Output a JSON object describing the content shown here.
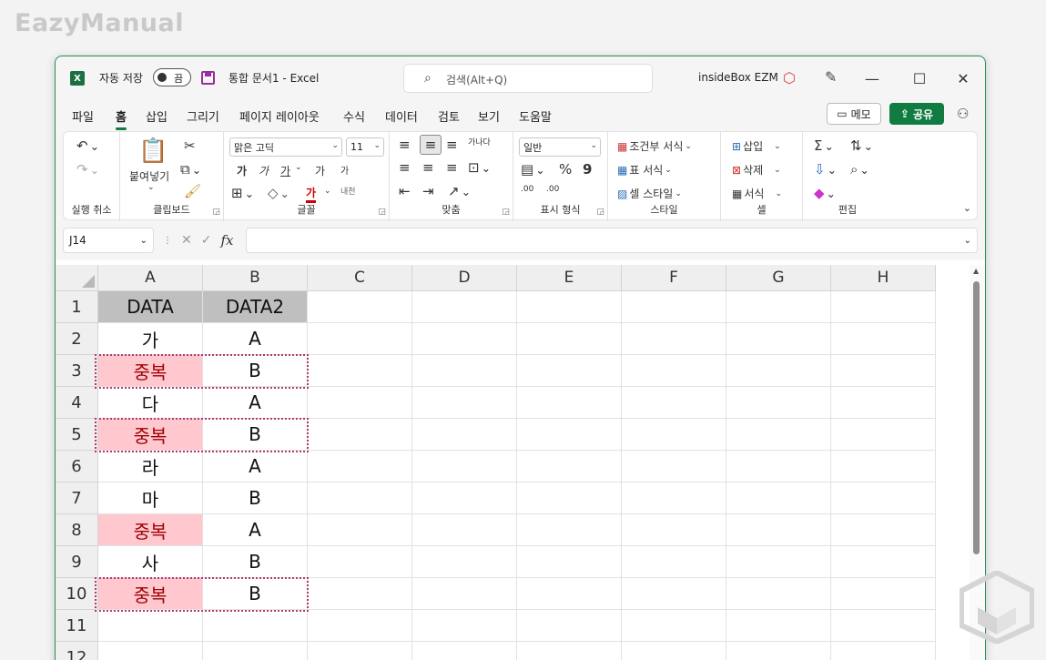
{
  "watermark": "EazyManual",
  "titlebar": {
    "app_icon": "X",
    "autosave_label": "자동 저장",
    "autosave_state": "끔",
    "doc_title": "통합 문서1  -  Excel",
    "search_placeholder": "검색(Alt+Q)",
    "account": "insideBox EZM",
    "minimize": "—",
    "maximize": "☐",
    "close": "✕"
  },
  "menu": {
    "items": [
      "파일",
      "홈",
      "삽입",
      "그리기",
      "페이지 레이아웃",
      "수식",
      "데이터",
      "검토",
      "보기",
      "도움말"
    ],
    "active": "홈",
    "memo": "메모",
    "share": "공유"
  },
  "ribbon": {
    "undo_group": "실행 취소",
    "clipboard_group": "클립보드",
    "paste": "붙여넣기",
    "font_group": "글꼴",
    "font_name": "맑은 고딕",
    "font_size": "11",
    "bold": "가",
    "italic": "가",
    "underline": "가",
    "grow_font": "가",
    "shrink_font": "가",
    "font_color": "가",
    "phonetic": "내천",
    "align_group": "맞춤",
    "wrap": "가나다",
    "number_group": "표시 형식",
    "number_format": "일반",
    "percent": "%",
    "comma": "9",
    "dec_inc": ".00",
    "dec_dec": ".00",
    "style_group": "스타일",
    "conditional": "조건부 서식",
    "format_table": "표 서식",
    "cell_style": "셀 스타일",
    "cells_group": "셀",
    "insert": "삽입",
    "delete": "삭제",
    "format": "서식",
    "edit_group": "편집"
  },
  "formula": {
    "namebox": "J14",
    "fx": "fx",
    "cancel": "✕",
    "enter": "✓"
  },
  "sheet": {
    "columns": [
      "A",
      "B",
      "C",
      "D",
      "E",
      "F",
      "G",
      "H"
    ],
    "rows": [
      "1",
      "2",
      "3",
      "4",
      "5",
      "6",
      "7",
      "8",
      "9",
      "10",
      "11",
      "12"
    ],
    "data": [
      [
        "DATA",
        "DATA2"
      ],
      [
        "가",
        "A"
      ],
      [
        "중복",
        "B"
      ],
      [
        "다",
        "A"
      ],
      [
        "중복",
        "B"
      ],
      [
        "라",
        "A"
      ],
      [
        "마",
        "B"
      ],
      [
        "중복",
        "A"
      ],
      [
        "사",
        "B"
      ],
      [
        "중복",
        "B"
      ],
      [
        "",
        ""
      ],
      [
        "",
        ""
      ]
    ],
    "duplicate_fill": "#ffc7ce",
    "duplicate_text": "#9c0006",
    "header_fill": "#bfbfbf",
    "accent": "#107c41"
  }
}
